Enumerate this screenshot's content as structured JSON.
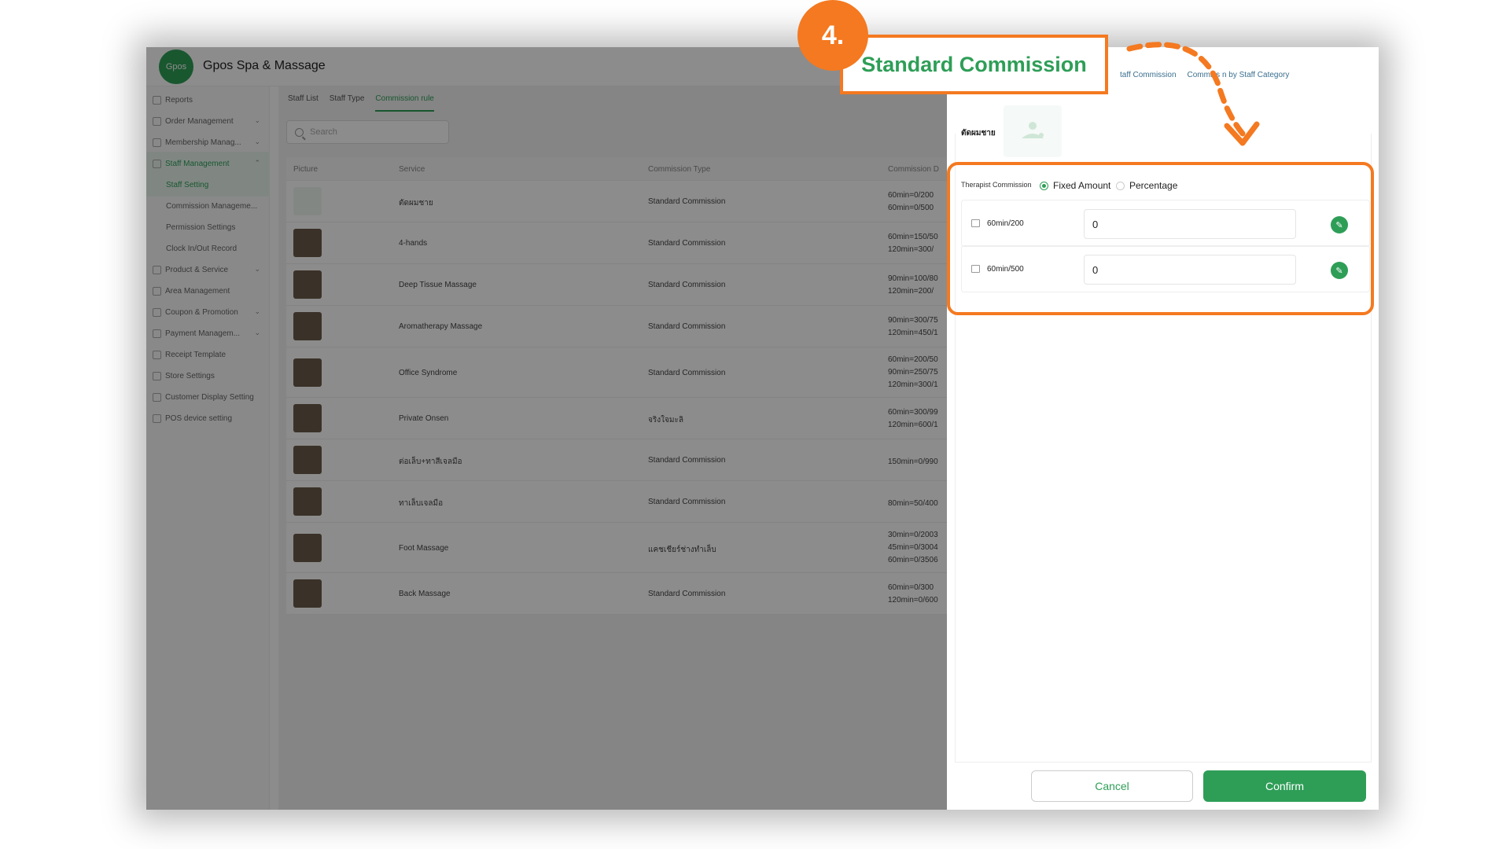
{
  "app": {
    "logo_text": "Gpos",
    "name": "Gpos Spa & Massage"
  },
  "sidebar": {
    "items": [
      {
        "label": "Reports",
        "chevron": ""
      },
      {
        "label": "Order Management",
        "chevron": "⌄"
      },
      {
        "label": "Membership Manag...",
        "chevron": "⌄"
      },
      {
        "label": "Staff Management",
        "chevron": "⌃"
      },
      {
        "label": "Staff Setting",
        "chevron": ""
      },
      {
        "label": "Commission Manageme...",
        "chevron": ""
      },
      {
        "label": "Permission Settings",
        "chevron": ""
      },
      {
        "label": "Clock In/Out Record",
        "chevron": ""
      },
      {
        "label": "Product & Service",
        "chevron": "⌄"
      },
      {
        "label": "Area Management",
        "chevron": ""
      },
      {
        "label": "Coupon & Promotion",
        "chevron": "⌄"
      },
      {
        "label": "Payment Managem...",
        "chevron": "⌄"
      },
      {
        "label": "Receipt Template",
        "chevron": ""
      },
      {
        "label": "Store Settings",
        "chevron": ""
      },
      {
        "label": "Customer Display Setting",
        "chevron": ""
      },
      {
        "label": "POS device setting",
        "chevron": ""
      }
    ]
  },
  "tabs": [
    "Staff List",
    "Staff Type",
    "Commission rule"
  ],
  "search": {
    "placeholder": "Search"
  },
  "table": {
    "headers": [
      "Picture",
      "Service",
      "Commission Type",
      "Commission D"
    ],
    "rows": [
      {
        "service": "ตัดผมชาย",
        "ctype": "Standard Commission",
        "detail": [
          "60min=0/200",
          "60min=0/500"
        ]
      },
      {
        "service": "4-hands",
        "ctype": "Standard Commission",
        "detail": [
          "60min=150/50",
          "120min=300/"
        ]
      },
      {
        "service": "Deep Tissue Massage",
        "ctype": "Standard Commission",
        "detail": [
          "90min=100/80",
          "120min=200/"
        ]
      },
      {
        "service": "Aromatherapy Massage",
        "ctype": "Standard Commission",
        "detail": [
          "90min=300/75",
          "120min=450/1"
        ]
      },
      {
        "service": "Office Syndrome",
        "ctype": "Standard Commission",
        "detail": [
          "60min=200/50",
          "90min=250/75",
          "120min=300/1"
        ]
      },
      {
        "service": "Private Onsen",
        "ctype": "จริงใจมะลิ",
        "detail": [
          "60min=300/99",
          "120min=600/1"
        ]
      },
      {
        "service": "ต่อเล็บ+ทาสีเจลมือ",
        "ctype": "Standard Commission",
        "detail": [
          "150min=0/990"
        ]
      },
      {
        "service": "ทาเล็บเจลมือ",
        "ctype": "Standard Commission",
        "detail": [
          "80min=50/400"
        ]
      },
      {
        "service": "Foot Massage",
        "ctype": "แคชเชียร์ช่างทำเล็บ",
        "detail": [
          "30min=0/2003",
          "45min=0/3004",
          "60min=0/3506"
        ]
      },
      {
        "service": "Back Massage",
        "ctype": "Standard Commission",
        "detail": [
          "60min=0/300",
          "120min=0/600"
        ]
      }
    ]
  },
  "drawer": {
    "tabs": [
      "taff Commission",
      "Commiss    n by Staff Category"
    ],
    "service_name": "ตัดผมชาย",
    "therapist_label": "Therapist Commission",
    "radio_fixed": "Fixed Amount",
    "radio_percent": "Percentage",
    "rows": [
      {
        "label": "60min/200",
        "value": "0"
      },
      {
        "label": "60min/500",
        "value": "0"
      }
    ],
    "cancel": "Cancel",
    "confirm": "Confirm"
  },
  "callout": {
    "step": "4.",
    "title": "Standard Commission"
  },
  "colors": {
    "brand_green": "#2e9e57",
    "callout_orange": "#f47920"
  }
}
